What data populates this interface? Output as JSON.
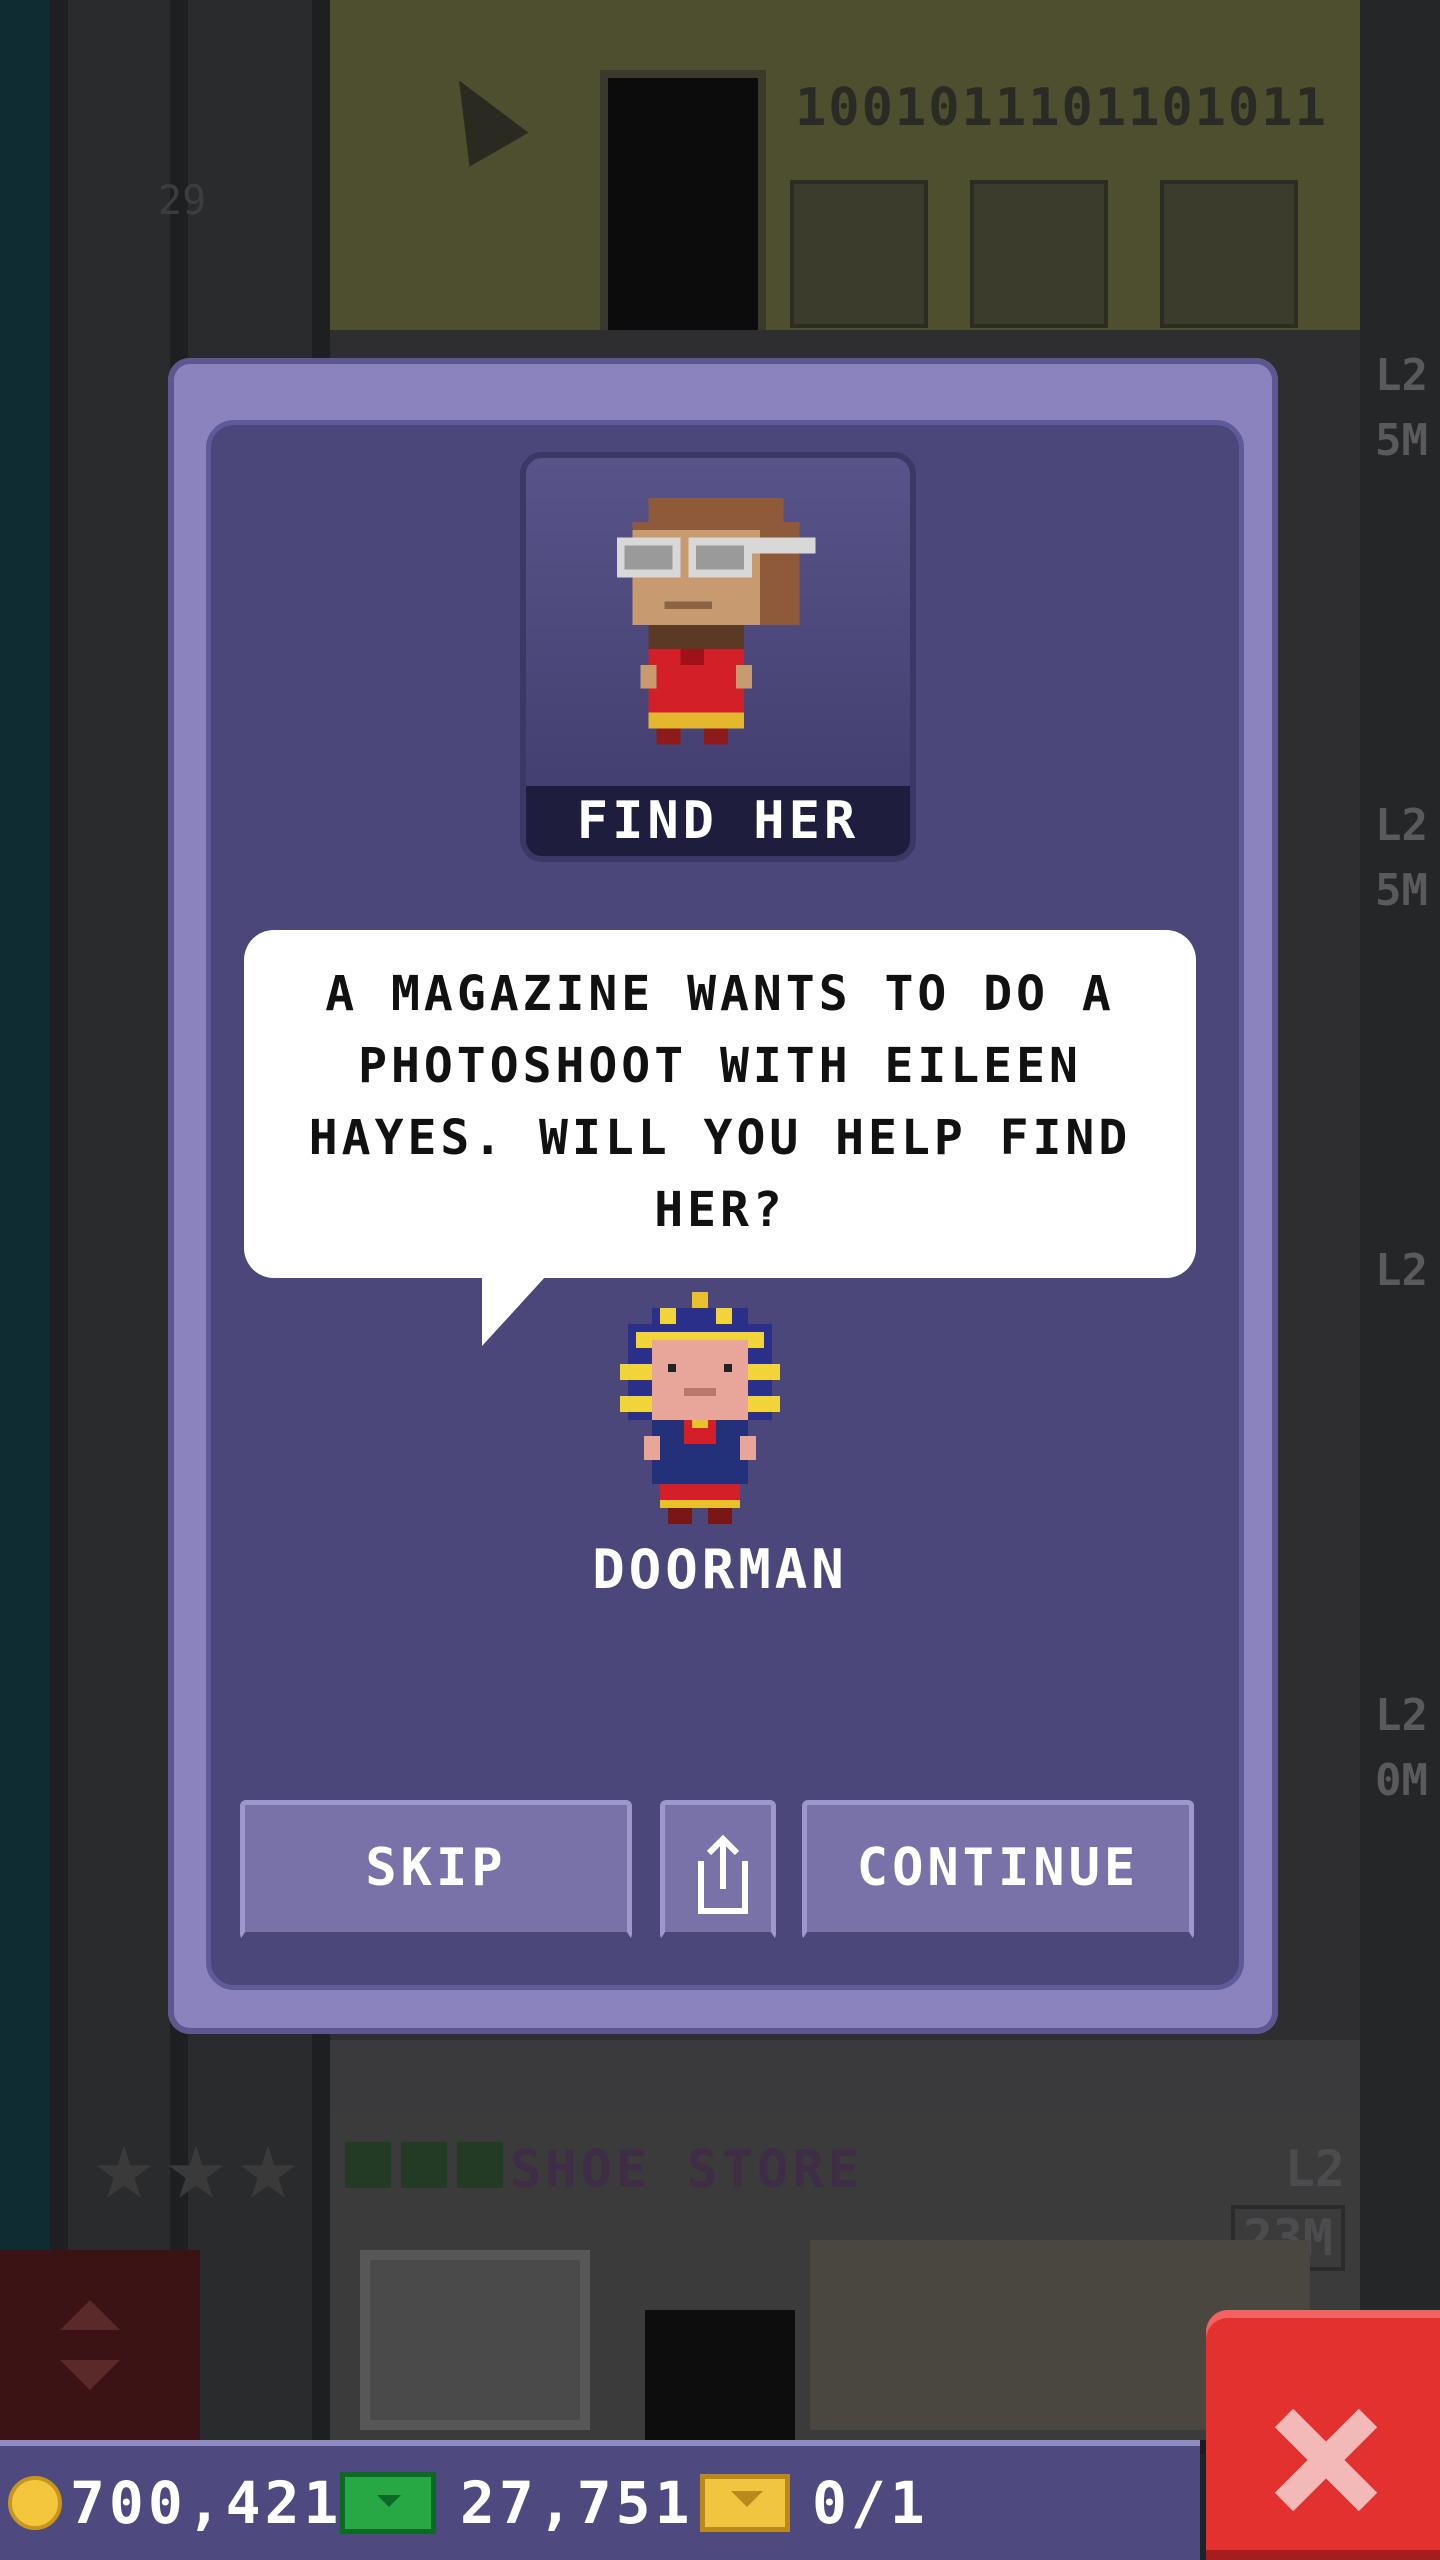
{
  "scene": {
    "office_binary": "1001011101101011",
    "floor_number": "29",
    "side_labels": [
      "L2",
      "5M",
      "L2",
      "5M",
      "L2",
      "L2",
      "0M"
    ],
    "shoe_store": {
      "title": "SHOE STORE",
      "level": "L2",
      "income": "23M"
    }
  },
  "dialog": {
    "banner": "FIND HER",
    "message": "A MAGAZINE WANTS TO DO A PHOTOSHOOT WITH EILEEN HAYES. WILL YOU HELP FIND HER?",
    "speaker": "DOORMAN",
    "buttons": {
      "skip": "SKIP",
      "continue": "CONTINUE"
    },
    "icons": {
      "share": "share-icon"
    }
  },
  "hud": {
    "coins": "700,421",
    "bux": "27,751",
    "tickets": "0/1",
    "colors": {
      "coin": "#f4c63c",
      "bux": "#28a844",
      "ticket": "#f2c541"
    }
  },
  "close": {
    "icon": "close-icon",
    "color": "#e3312f"
  }
}
